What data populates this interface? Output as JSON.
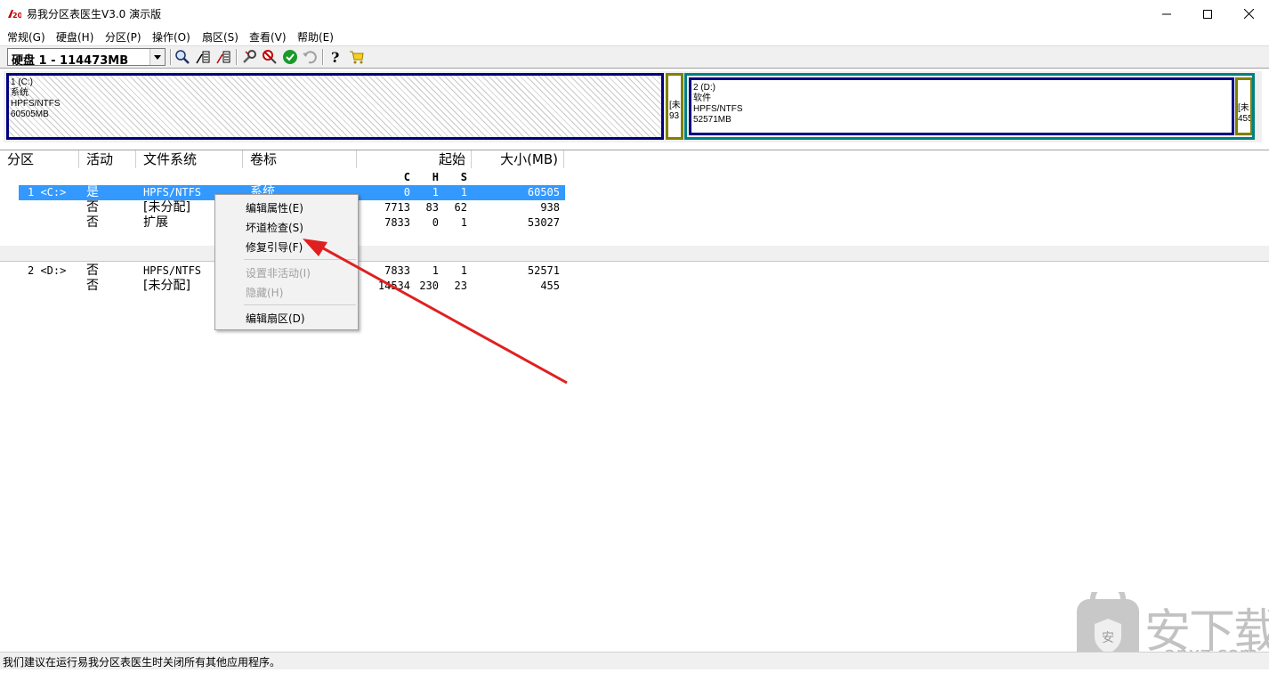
{
  "window": {
    "title": "易我分区表医生V3.0 演示版",
    "controls": [
      "minimize",
      "maximize",
      "close"
    ]
  },
  "menubar": {
    "items": [
      {
        "label": "常规(G)"
      },
      {
        "label": "硬盘(H)"
      },
      {
        "label": "分区(P)"
      },
      {
        "label": "操作(O)"
      },
      {
        "label": "扇区(S)"
      },
      {
        "label": "查看(V)"
      },
      {
        "label": "帮助(E)"
      }
    ]
  },
  "toolbar": {
    "disk_selector_value": "硬盘 1 - 114473MB",
    "icons": [
      "search-disk-icon",
      "edit-partition-icon",
      "edit-sector-icon",
      "repair-tool-icon",
      "stop-icon",
      "apply-icon",
      "undo-icon",
      "help-icon",
      "cart-icon"
    ]
  },
  "disk_map": {
    "partitions": [
      {
        "lines": [
          "1 (C:)",
          "系统",
          "HPFS/NTFS",
          "60505MB"
        ]
      },
      {
        "lines": [
          "[未",
          "93"
        ]
      },
      {
        "lines": [
          "2 (D:)",
          "软件",
          "HPFS/NTFS",
          "52571MB"
        ]
      },
      {
        "lines": [
          "[未",
          "455"
        ]
      }
    ]
  },
  "table": {
    "columns": [
      "分区",
      "活动",
      "文件系统",
      "卷标",
      "起始",
      "大小(MB)"
    ],
    "chs_header": [
      "C",
      "H",
      "S"
    ],
    "group1": [
      {
        "partition": "1 <C:>",
        "active": "是",
        "fs": "HPFS/NTFS",
        "label": "系统",
        "c": "0",
        "h": "1",
        "s": "1",
        "size": "60505"
      },
      {
        "partition": "",
        "active": "否",
        "fs": "[未分配]",
        "label": "",
        "c": "7713",
        "h": "83",
        "s": "62",
        "size": "938"
      },
      {
        "partition": "",
        "active": "否",
        "fs": "扩展",
        "label": "",
        "c": "7833",
        "h": "0",
        "s": "1",
        "size": "53027"
      }
    ],
    "group2": [
      {
        "partition": "2 <D:>",
        "active": "否",
        "fs": "HPFS/NTFS",
        "label": "",
        "c": "7833",
        "h": "1",
        "s": "1",
        "size": "52571"
      },
      {
        "partition": "",
        "active": "否",
        "fs": "[未分配]",
        "label": "",
        "c": "14534",
        "h": "230",
        "s": "23",
        "size": "455"
      }
    ]
  },
  "context_menu": {
    "items": [
      {
        "label": "编辑属性(E)",
        "enabled": true
      },
      {
        "label": "坏道检查(S)",
        "enabled": true
      },
      {
        "label": "修复引导(F)",
        "enabled": true
      },
      {
        "label": "设置非活动(I)",
        "enabled": false
      },
      {
        "label": "隐藏(H)",
        "enabled": false
      },
      {
        "label": "编辑扇区(D)",
        "enabled": true
      }
    ]
  },
  "statusbar": {
    "text": "我们建议在运行易我分区表医生时关闭所有其他应用程序。"
  },
  "watermark": {
    "text_main": "安下载",
    "text_small": "anxz.com"
  },
  "colors": {
    "selection": "#3399ff",
    "partition_primary_border": "#000080",
    "logical_border": "#008080",
    "unallocated_border": "#808000",
    "annotation_arrow": "#e02020"
  }
}
